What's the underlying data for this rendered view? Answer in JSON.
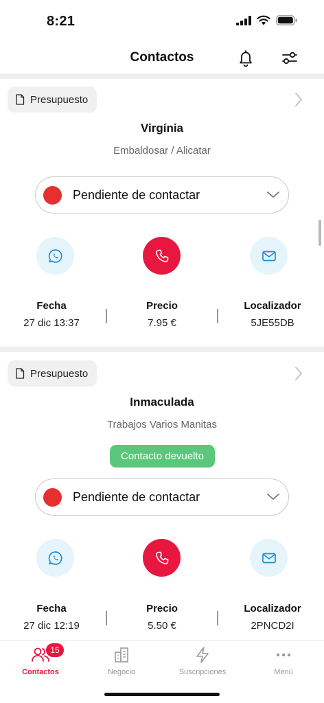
{
  "status_bar": {
    "time": "8:21"
  },
  "header": {
    "title": "Contactos",
    "bell_icon": "bell-icon",
    "filter_icon": "sliders-icon"
  },
  "labels": {
    "fecha": "Fecha",
    "precio": "Precio",
    "localizador": "Localizador"
  },
  "contacts": [
    {
      "chip_label": "Presupuesto",
      "name": "Virgínia",
      "category": "Embaldosar / Alicatar",
      "status": "Pendiente de contactar",
      "status_color": "#e53030",
      "fecha": "27 dic 13:37",
      "precio": "7.95 €",
      "localizador": "5JE55DB"
    },
    {
      "chip_label": "Presupuesto",
      "name": "Inmaculada",
      "category": "Trabajos Varios Manitas",
      "badge": "Contacto devuelto",
      "status": "Pendiente de contactar",
      "status_color": "#e53030",
      "fecha": "27 dic 12:19",
      "precio": "5.50 €",
      "localizador": "2PNCD2I"
    }
  ],
  "tabs": [
    {
      "label": "Contactos",
      "icon": "users-icon",
      "badge": "15",
      "active": true
    },
    {
      "label": "Negocio",
      "icon": "building-icon"
    },
    {
      "label": "Suscripciones",
      "icon": "bolt-icon"
    },
    {
      "label": "Menú",
      "icon": "more-icon"
    }
  ],
  "colors": {
    "accent": "#e7173f",
    "status_pending": "#e53030",
    "returned_badge": "#5bc77a",
    "action_bg": "#e6f4fb",
    "icon_blue": "#1e8fcf"
  }
}
